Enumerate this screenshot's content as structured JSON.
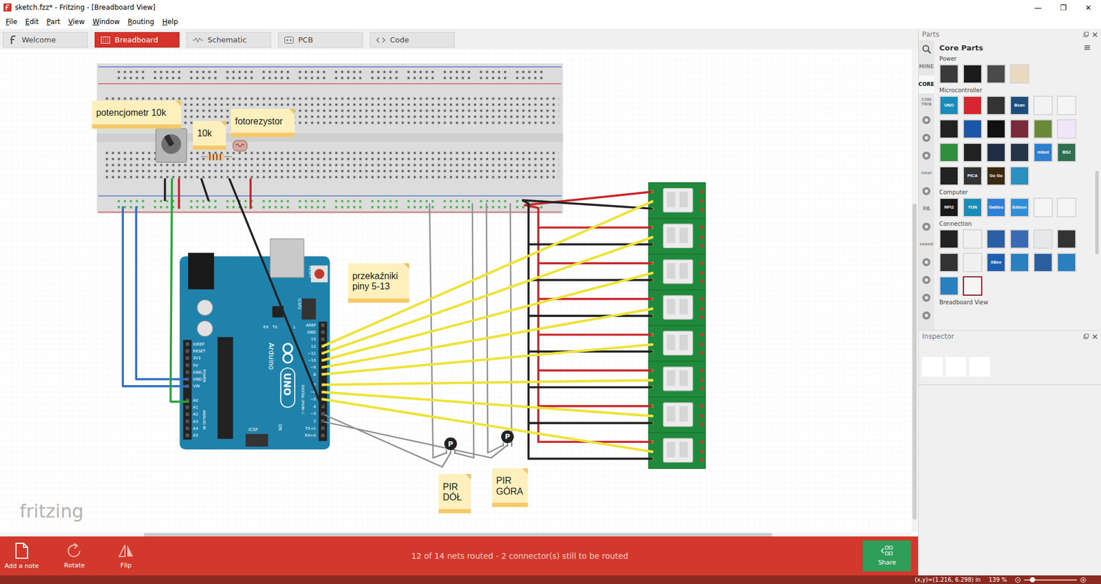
{
  "window": {
    "title": "sketch.fzz* - Fritzing - [Breadboard View]",
    "controls": [
      "—",
      "❐",
      "✕"
    ]
  },
  "menu": [
    "File",
    "Edit",
    "Part",
    "View",
    "Window",
    "Routing",
    "Help"
  ],
  "tabs": [
    {
      "label": "Welcome",
      "selected": false
    },
    {
      "label": "Breadboard",
      "selected": true
    },
    {
      "label": "Schematic",
      "selected": false
    },
    {
      "label": "PCB",
      "selected": false
    },
    {
      "label": "Code",
      "selected": false
    }
  ],
  "canvas": {
    "notes": [
      {
        "lines": [
          "potencjometr 10k"
        ]
      },
      {
        "lines": [
          "10k"
        ]
      },
      {
        "lines": [
          "fotorezystor"
        ]
      },
      {
        "lines": [
          "przekaźniki",
          "piny 5-13"
        ]
      },
      {
        "lines": [
          "PIR",
          "DÓŁ"
        ]
      },
      {
        "lines": [
          "PIR",
          "GÓRA"
        ]
      }
    ],
    "arduino": {
      "brand": "Arduino",
      "model": "UNO",
      "reset": "RESET",
      "icsp": "ICSP",
      "icsp2": "ICSP2",
      "on": "ON",
      "tx": "TX",
      "rx": "RX",
      "led": "L",
      "power_group": "POWER",
      "analog_group": "ANALOG IN",
      "digital_group": "DIGITAL (PWM~)",
      "digital_pins": [
        "AREF",
        "GND",
        "13",
        "12",
        "~11",
        "~10",
        "~9",
        "8",
        "7",
        "~6",
        "~5",
        "4",
        "~3",
        "2",
        "TX→1",
        "RX←0"
      ],
      "power_pins": [
        "IOREF",
        "RESET",
        "3V3",
        "5V",
        "GND",
        "GND",
        "VIN"
      ],
      "analog_pins": [
        "A0",
        "A1",
        "A2",
        "A3",
        "A4",
        "A5"
      ]
    },
    "pir_mark": "P",
    "watermark": "fritzing"
  },
  "parts": {
    "title": "Parts",
    "bin_title": "Core Parts",
    "bin_tabs": [
      {
        "label": "MINE",
        "kind": "text",
        "selected": false
      },
      {
        "label": "CORE",
        "kind": "text",
        "selected": true
      },
      {
        "label": "CON TRIB",
        "kind": "text",
        "selected": false
      },
      {
        "kind": "icon",
        "selected": false
      },
      {
        "kind": "icon",
        "selected": false
      },
      {
        "kind": "icon",
        "selected": false
      },
      {
        "label": "intel",
        "kind": "text",
        "selected": false
      },
      {
        "kind": "icon",
        "selected": false
      },
      {
        "label": "PA",
        "kind": "text",
        "selected": false
      },
      {
        "kind": "icon",
        "selected": false
      },
      {
        "label": "seeed",
        "kind": "text",
        "selected": false
      },
      {
        "kind": "icon",
        "selected": false
      },
      {
        "kind": "icon",
        "selected": false
      },
      {
        "kind": "icon",
        "selected": false
      },
      {
        "kind": "icon",
        "selected": false
      }
    ],
    "sections": [
      {
        "title": "Power",
        "tiles": [
          {
            "label": "",
            "color": "#3a3a3a",
            "selected": false
          },
          {
            "label": "",
            "color": "#1b1b1b",
            "selected": false
          },
          {
            "label": "",
            "color": "#4a4a4a",
            "selected": false
          },
          {
            "label": "",
            "color": "#e8d9c0",
            "selected": false
          }
        ]
      },
      {
        "title": "Microcontroller",
        "tiles": [
          {
            "label": "UNO",
            "color": "#1a8cba",
            "selected": false
          },
          {
            "label": "",
            "color": "#d6262f",
            "selected": false
          },
          {
            "label": "",
            "color": "#333333",
            "selected": false
          },
          {
            "label": "Bean",
            "color": "#1f4d7a",
            "selected": false
          },
          {
            "label": "",
            "color": "#f2f2f2",
            "selected": false
          },
          {
            "label": "",
            "color": "#f5f5f5",
            "selected": false
          },
          {
            "label": "",
            "color": "#222222",
            "selected": false
          },
          {
            "label": "",
            "color": "#1c56a8",
            "selected": false
          },
          {
            "label": "",
            "color": "#111111",
            "selected": false
          },
          {
            "label": "",
            "color": "#7a2b3b",
            "selected": false
          },
          {
            "label": "",
            "color": "#6a8a3a",
            "selected": false
          },
          {
            "label": "",
            "color": "#f0e6f7",
            "selected": false
          },
          {
            "label": "",
            "color": "#2f8f3f",
            "selected": false
          },
          {
            "label": "",
            "color": "#222222",
            "selected": false
          },
          {
            "label": "",
            "color": "#1f2d45",
            "selected": false
          },
          {
            "label": "",
            "color": "#253548",
            "selected": false
          },
          {
            "label": "mbed",
            "color": "#2f7fcf",
            "selected": false
          },
          {
            "label": "BS2",
            "color": "#2f6f4f",
            "selected": false
          },
          {
            "label": "",
            "color": "#222222",
            "selected": false
          },
          {
            "label": "PICA",
            "color": "#333333",
            "selected": false
          },
          {
            "label": "Go Go",
            "color": "#3a2a10",
            "selected": false
          },
          {
            "label": "",
            "color": "#2b8fbf",
            "selected": false
          }
        ]
      },
      {
        "title": "Computer",
        "tiles": [
          {
            "label": "RPi2",
            "color": "#1a1a1a",
            "selected": false
          },
          {
            "label": "YUN",
            "color": "#1a8cba",
            "selected": false
          },
          {
            "label": "Galileo",
            "color": "#2f7fd6",
            "selected": false
          },
          {
            "label": "Edison",
            "color": "#2f8fd6",
            "selected": false
          },
          {
            "label": "",
            "color": "#f5f5f5",
            "selected": false
          },
          {
            "label": "",
            "color": "#f5f5f5",
            "selected": false
          }
        ]
      },
      {
        "title": "Connection",
        "tiles": [
          {
            "label": "",
            "color": "#222222",
            "selected": false
          },
          {
            "label": "",
            "color": "#f0f0f0",
            "selected": false
          },
          {
            "label": "",
            "color": "#2a5fa6",
            "selected": false
          },
          {
            "label": "",
            "color": "#3a6ab0",
            "selected": false
          },
          {
            "label": "",
            "color": "#e8e8e8",
            "selected": false
          },
          {
            "label": "",
            "color": "#333333",
            "selected": false
          },
          {
            "label": "",
            "color": "#333333",
            "selected": false
          },
          {
            "label": "",
            "color": "#f0f0f0",
            "selected": false
          },
          {
            "label": "XBee",
            "color": "#1f5fb0",
            "selected": false
          },
          {
            "label": "",
            "color": "#2a7fbf",
            "selected": false
          },
          {
            "label": "",
            "color": "#2b5f9f",
            "selected": false
          },
          {
            "label": "",
            "color": "#2a7fbf",
            "selected": false
          },
          {
            "label": "",
            "color": "#2a7fbf",
            "selected": false
          },
          {
            "label": "",
            "color": "#f5f5f5",
            "selected": true
          }
        ]
      },
      {
        "title": "Breadboard View",
        "tiles": []
      }
    ]
  },
  "inspector": {
    "title": "Inspector"
  },
  "bottom_bar": {
    "buttons": [
      "Add a note",
      "Rotate",
      "Flip"
    ],
    "routing_status": "12 of 14 nets routed - 2 connector(s) still to be routed",
    "share": "Share"
  },
  "status_bar": {
    "coords": "(x,y)=(1.216, 6.298) in",
    "zoom": "139 %",
    "zoom_level": 0.15
  }
}
